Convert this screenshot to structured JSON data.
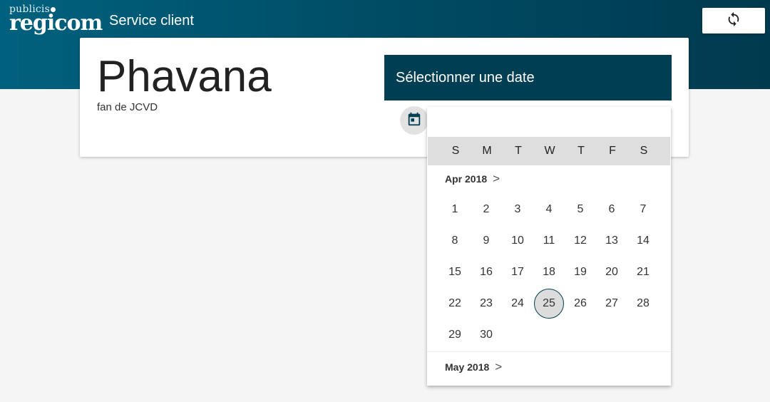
{
  "header": {
    "logo_small": "publicis",
    "logo_big": "regicom",
    "app_title": "Service client",
    "refresh_icon": "refresh-icon"
  },
  "customer": {
    "name": "Phavana",
    "subtitle": "fan de JCVD"
  },
  "date_picker": {
    "header_label": "Sélectionner une date",
    "toggle_icon": "calendar-icon",
    "weekdays": [
      "S",
      "M",
      "T",
      "W",
      "T",
      "F",
      "S"
    ],
    "current_month": {
      "label": "Apr 2018",
      "chevron": ">",
      "days": [
        "1",
        "2",
        "3",
        "4",
        "5",
        "6",
        "7",
        "8",
        "9",
        "10",
        "11",
        "12",
        "13",
        "14",
        "15",
        "16",
        "17",
        "18",
        "19",
        "20",
        "21",
        "22",
        "23",
        "24",
        "25",
        "26",
        "27",
        "28",
        "29",
        "30"
      ],
      "first_weekday_index": 0,
      "selected_day": "25"
    },
    "next_month": {
      "label": "May 2018",
      "chevron": ">"
    }
  },
  "colors": {
    "header_gradient_start": "#00617e",
    "header_gradient_end": "#003a4f",
    "accent": "#003e54",
    "weekday_bar": "#dedede",
    "background": "#f5f5f5"
  }
}
